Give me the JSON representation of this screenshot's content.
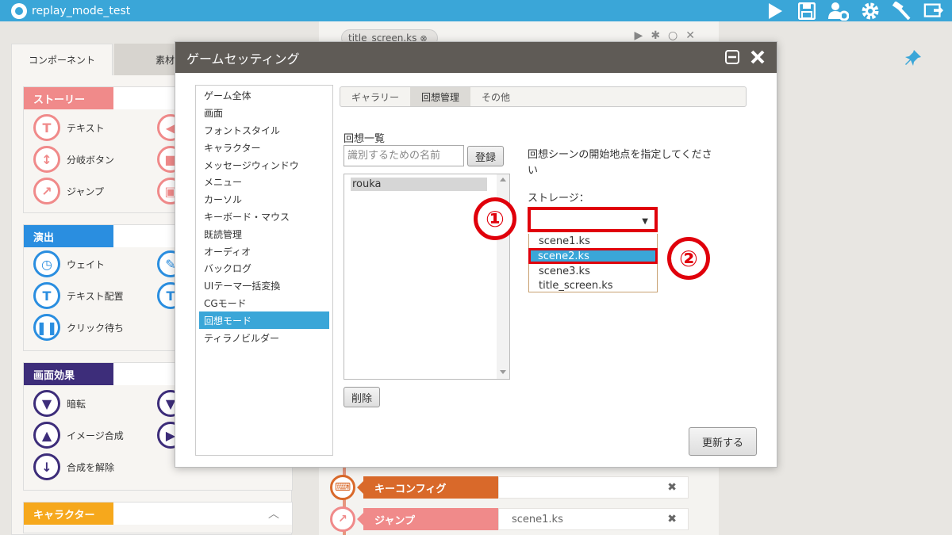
{
  "app": {
    "title": "replay_mode_test"
  },
  "toolbar": {
    "icons": [
      "play-icon",
      "save-icon",
      "users-gear-icon",
      "gear-icon",
      "hammer-icon",
      "export-icon"
    ]
  },
  "left_panel": {
    "tabs": [
      {
        "label": "コンポーネント"
      },
      {
        "label": "素材"
      }
    ],
    "sections": [
      {
        "label": "ストーリー",
        "color": "#f08a8a",
        "items": [
          {
            "label": "テキスト",
            "icon": "text-icon"
          },
          {
            "label": "分岐ボタン",
            "icon": "branch-icon"
          },
          {
            "label": "ジャンプ",
            "icon": "jump-icon"
          }
        ]
      },
      {
        "label": "演出",
        "color": "#2a8ee0",
        "items": [
          {
            "label": "ウェイト",
            "icon": "clock-icon"
          },
          {
            "label": "テキスト配置",
            "icon": "text-position-icon"
          },
          {
            "label": "クリック待ち",
            "icon": "pause-icon"
          }
        ]
      },
      {
        "label": "画面効果",
        "color": "#3d2d7a",
        "items": [
          {
            "label": "暗転",
            "icon": "blackout-icon"
          },
          {
            "label": "イメージ合成",
            "icon": "image-compose-icon"
          },
          {
            "label": "合成を解除",
            "icon": "compose-release-icon"
          }
        ]
      },
      {
        "label": "キャラクター",
        "color": "#f6a81c",
        "items": []
      }
    ]
  },
  "editor": {
    "file_tab": "title_screen.ks",
    "timeline": [
      {
        "label": "キーコンフィグ",
        "param": "",
        "color": "#d9692a",
        "icon": "keyboard-icon"
      },
      {
        "label": "ジャンプ",
        "param": "scene1.ks",
        "color": "#f08a8a",
        "icon": "jump-icon"
      }
    ]
  },
  "modal": {
    "title": "ゲームセッティング",
    "menu": [
      "ゲーム全体",
      "画面",
      "フォントスタイル",
      "キャラクター",
      "メッセージウィンドウ",
      "メニュー",
      "カーソル",
      "キーボード・マウス",
      "既読管理",
      "オーディオ",
      "バックログ",
      "UIテーマ一括変換",
      "CGモード",
      "回想モード",
      "ティラノビルダー"
    ],
    "menu_selected": "回想モード",
    "subtabs": [
      "ギャラリー",
      "回想管理",
      "その他"
    ],
    "subtab_active": "回想管理",
    "list_label": "回想一覧",
    "name_placeholder": "識別するための名前",
    "register_label": "登録",
    "replays": [
      "rouka"
    ],
    "delete_label": "削除",
    "instruction": "回想シーンの開始地点を指定してください",
    "storage_label": "ストレージ：",
    "storage_value": "",
    "storage_options": [
      "scene1.ks",
      "scene2.ks",
      "scene3.ks",
      "title_screen.ks"
    ],
    "storage_highlighted": "scene2.ks",
    "update_label": "更新する",
    "step_marks": [
      "①",
      "②"
    ]
  },
  "colors": {
    "accent": "#3aa6d8",
    "header": "#5f5b56",
    "highlight_border": "#e0000b"
  }
}
